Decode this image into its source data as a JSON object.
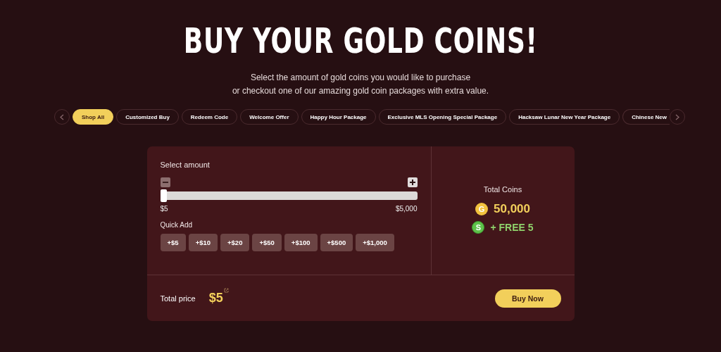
{
  "title": "BUY YOUR GOLD COINS!",
  "subtitle_lines": [
    "Select the amount of gold coins you would like to purchase",
    "or checkout one of our amazing gold coin packages with extra value."
  ],
  "tabs": [
    {
      "label": "Shop All",
      "selected": true,
      "cut": false
    },
    {
      "label": "Customized Buy",
      "selected": false,
      "cut": false
    },
    {
      "label": "Redeem Code",
      "selected": false,
      "cut": false
    },
    {
      "label": "Welcome Offer",
      "selected": false,
      "cut": false
    },
    {
      "label": "Happy Hour Package",
      "selected": false,
      "cut": false
    },
    {
      "label": "Exclusive MLS Opening Special Package",
      "selected": false,
      "cut": false
    },
    {
      "label": "Hacksaw Lunar New Year Package",
      "selected": false,
      "cut": false
    },
    {
      "label": "Chinese New",
      "selected": false,
      "cut": true
    }
  ],
  "amount": {
    "label": "Select amount",
    "level": 0,
    "min_label": "$5",
    "max_label": "$5,000"
  },
  "quick_add": {
    "label": "Quick Add",
    "buttons": [
      "+$5",
      "+$10",
      "+$20",
      "+$50",
      "+$100",
      "+$500",
      "+$1,000"
    ]
  },
  "total_coins": {
    "label": "Total Coins",
    "gold_letter": "G",
    "gold": "50,000",
    "free_letter": "S",
    "free": "+ FREE 5"
  },
  "total_price": {
    "label": "Total price",
    "value": "$5"
  },
  "buy_button": "Buy Now"
}
